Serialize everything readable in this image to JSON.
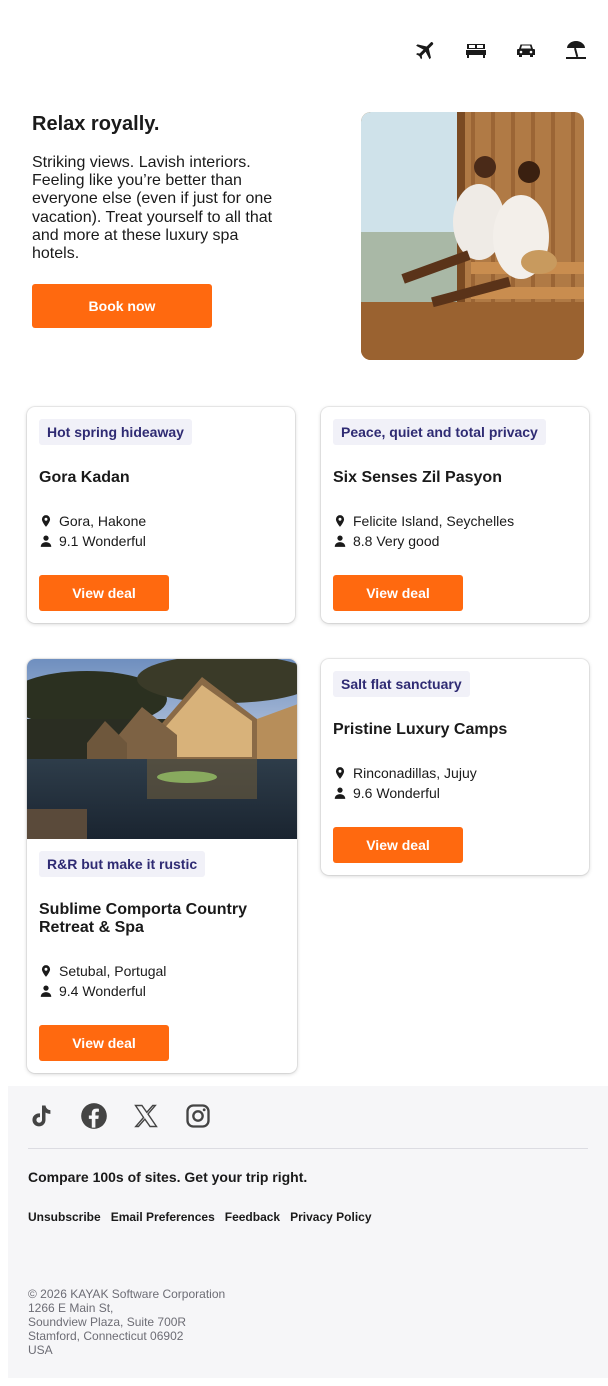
{
  "nav_icons": [
    "flight-icon",
    "hotel-bed-icon",
    "car-icon",
    "beach-umbrella-icon"
  ],
  "hero": {
    "title": "Relax royally.",
    "text": "Striking views. Lavish interiors. Feeling like you’re better than everyone else (even if just for one vacation). Treat yourself to all that and more at these luxury spa hotels.",
    "button": "Book now"
  },
  "cards": [
    {
      "tag": "Hot spring hideaway",
      "name": "Gora Kadan",
      "location": "Gora, Hakone",
      "rating": "9.1 Wonderful",
      "button": "View deal"
    },
    {
      "tag": "Peace, quiet and total privacy",
      "name": "Six Senses Zil Pasyon",
      "location": "Felicite Island, Seychelles",
      "rating": "8.8 Very good",
      "button": "View deal"
    },
    {
      "tag": "R&R but make it rustic",
      "name": "Sublime Comporta Country Retreat & Spa",
      "location": "Setubal, Portugal",
      "rating": "9.4 Wonderful",
      "button": "View deal"
    },
    {
      "tag": "Salt flat sanctuary",
      "name": "Pristine Luxury Camps",
      "location": "Rinconadillas, Jujuy",
      "rating": "9.6 Wonderful",
      "button": "View deal"
    }
  ],
  "footer": {
    "social": [
      "tiktok-icon",
      "facebook-icon",
      "x-icon",
      "instagram-icon"
    ],
    "tagline": "Compare 100s of sites. Get your trip right.",
    "links": [
      "Unsubscribe",
      "Email Preferences",
      "Feedback",
      "Privacy Policy"
    ],
    "address": [
      "© 2026 KAYAK Software Corporation",
      "1266 E Main St,",
      "Soundview Plaza, Suite 700R",
      "Stamford, Connecticut 06902",
      "USA"
    ]
  },
  "colors": {
    "accent": "#ff690f",
    "tag_bg": "#f1f1f8",
    "tag_text": "#2f2b73",
    "footer_bg": "#f6f6f8"
  }
}
